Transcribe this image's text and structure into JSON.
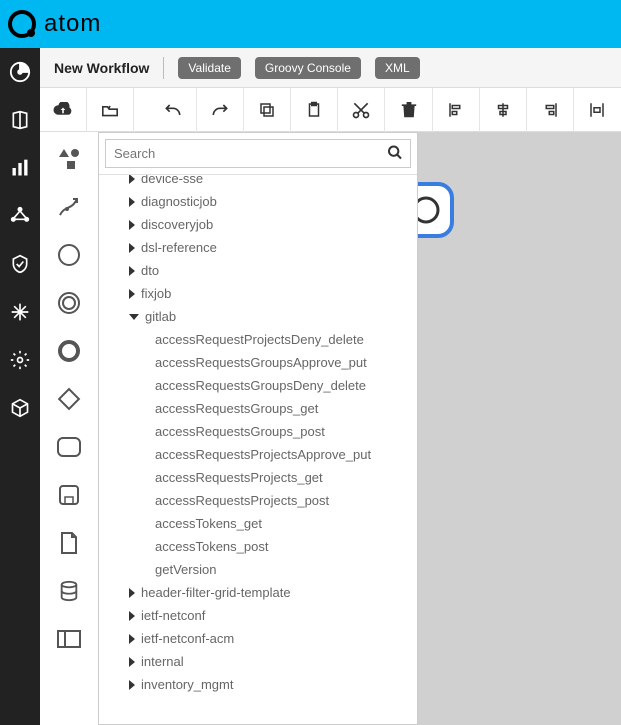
{
  "app": {
    "name": "atom"
  },
  "header": {
    "workflow_label": "New Workflow",
    "buttons": {
      "validate": "Validate",
      "groovy": "Groovy Console",
      "xml": "XML"
    }
  },
  "search": {
    "placeholder": "Search",
    "value": ""
  },
  "tree": {
    "nodes": [
      {
        "label": "device-sse",
        "expanded": false,
        "cutoff": true
      },
      {
        "label": "diagnosticjob",
        "expanded": false
      },
      {
        "label": "discoveryjob",
        "expanded": false
      },
      {
        "label": "dsl-reference",
        "expanded": false
      },
      {
        "label": "dto",
        "expanded": false
      },
      {
        "label": "fixjob",
        "expanded": false
      },
      {
        "label": "gitlab",
        "expanded": true,
        "children": [
          "accessRequestProjectsDeny_delete",
          "accessRequestsGroupsApprove_put",
          "accessRequestsGroupsDeny_delete",
          "accessRequestsGroups_get",
          "accessRequestsGroups_post",
          "accessRequestsProjectsApprove_put",
          "accessRequestsProjects_get",
          "accessRequestsProjects_post",
          "accessTokens_get",
          "accessTokens_post",
          "getVersion"
        ]
      },
      {
        "label": "header-filter-grid-template",
        "expanded": false
      },
      {
        "label": "ietf-netconf",
        "expanded": false
      },
      {
        "label": "ietf-netconf-acm",
        "expanded": false
      },
      {
        "label": "internal",
        "expanded": false
      },
      {
        "label": "inventory_mgmt",
        "expanded": false
      }
    ]
  }
}
